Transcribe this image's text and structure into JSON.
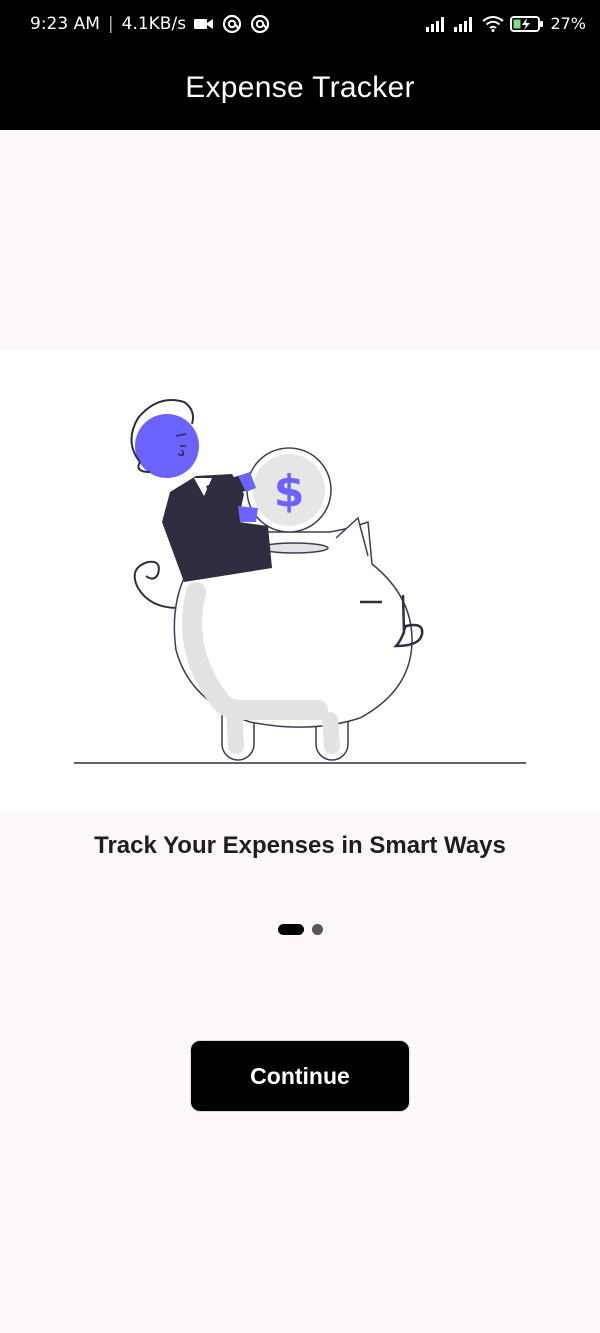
{
  "status_bar": {
    "time": "9:23 AM",
    "network_speed": "4.1KB/s",
    "battery_percent": "27%",
    "icons": [
      "video-camera-icon",
      "at-sign-icon",
      "at-sign-icon",
      "signal-icon",
      "signal-icon",
      "wifi-icon",
      "battery-charging-icon"
    ]
  },
  "app_bar": {
    "title": "Expense Tracker"
  },
  "onboarding": {
    "headline": "Track Your Expenses in Smart Ways",
    "illustration": "piggy-bank-illustration",
    "page_indicator": {
      "current_page": 1,
      "total_pages": 2
    },
    "continue_label": "Continue",
    "coin_symbol": "$"
  },
  "colors": {
    "status_bar_bg": "#000000",
    "app_bar_bg": "#000000",
    "page_bg": "#fff8fa",
    "accent_purple": "#6c63ff",
    "button_bg": "#000000",
    "button_text": "#ffffff"
  }
}
